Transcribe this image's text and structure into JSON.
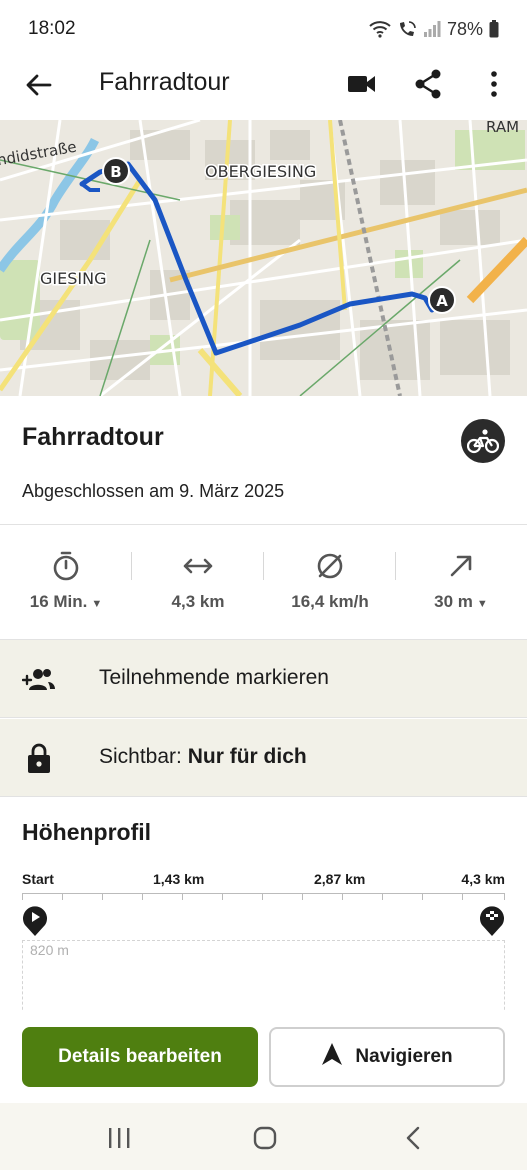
{
  "status": {
    "time": "18:02",
    "battery": "78%"
  },
  "app_bar": {
    "title": "Fahrradtour",
    "icons": [
      "back-arrow-icon",
      "video-icon",
      "share-icon",
      "more-vert-icon"
    ]
  },
  "map": {
    "labels": [
      "ndidstraße",
      "OBERGIESING",
      "GIESING",
      "RAM"
    ],
    "markers": {
      "start": "A",
      "end": "B"
    },
    "route_color": "#1a56c4"
  },
  "tour": {
    "name": "Fahrradtour",
    "subtitle": "Abgeschlossen am 9. März 2025",
    "sport_icon": "bicycle-icon"
  },
  "stats": [
    {
      "icon": "timer-icon",
      "value": "16 Min.",
      "dropdown": true
    },
    {
      "icon": "distance-icon",
      "value": "4,3 km",
      "dropdown": false
    },
    {
      "icon": "avg-speed-icon",
      "value": "16,4 km/h",
      "dropdown": false
    },
    {
      "icon": "elevation-up-icon",
      "value": "30 m",
      "dropdown": true
    }
  ],
  "rows": {
    "participants": {
      "label": "Teilnehmende markieren",
      "icon": "add-people-icon"
    },
    "visibility": {
      "prefix": "Sichtbar:",
      "value": "Nur für dich",
      "icon": "lock-icon"
    }
  },
  "elevation": {
    "title": "Höhenprofil",
    "distance_labels": [
      "Start",
      "1,43 km",
      "2,87 km",
      "4,3 km"
    ],
    "y_label": "820 m"
  },
  "actions": {
    "edit": "Details bearbeiten",
    "navigate": "Navigieren"
  },
  "colors": {
    "primary_green": "#4f7f10",
    "row_bg": "#f2f1e8",
    "route_blue": "#1a56c4"
  }
}
